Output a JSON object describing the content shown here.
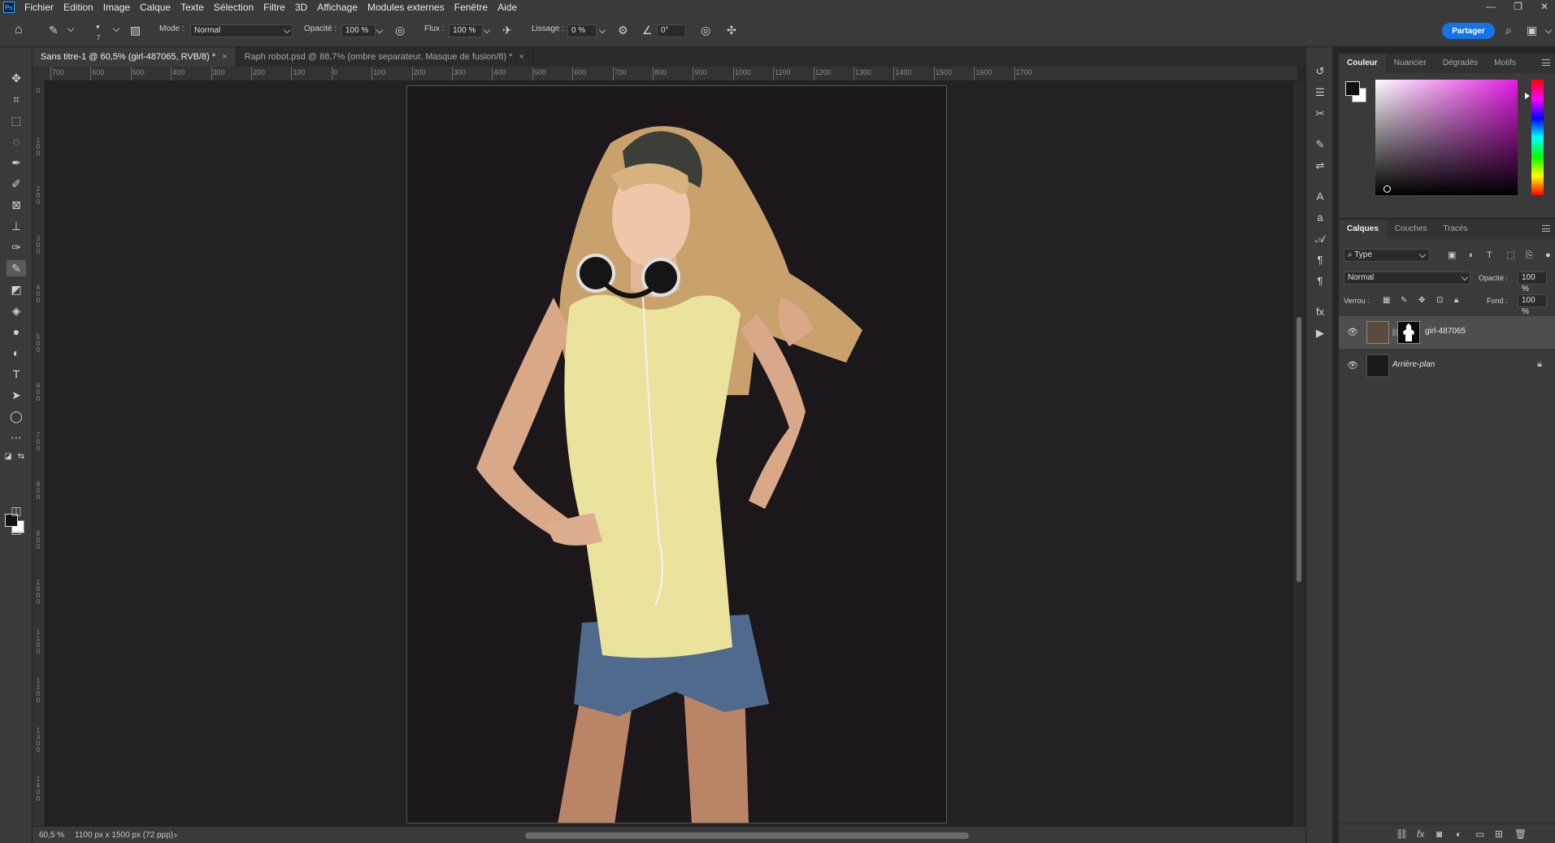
{
  "app": {
    "logo": "Ps"
  },
  "menu": [
    "Fichier",
    "Edition",
    "Image",
    "Calque",
    "Texte",
    "Sélection",
    "Filtre",
    "3D",
    "Affichage",
    "Modules externes",
    "Fenêtre",
    "Aide"
  ],
  "window_controls": [
    "—",
    "❐",
    "✕"
  ],
  "options": {
    "brush_size": "7",
    "mode_label": "Mode :",
    "mode_value": "Normal",
    "opacity_label": "Opacité :",
    "opacity_value": "100 %",
    "flow_label": "Flux :",
    "flow_value": "100 %",
    "smoothing_label": "Lissage :",
    "smoothing_value": "0 %",
    "angle_value": "0°",
    "share_label": "Partager"
  },
  "tabs": [
    {
      "label": "Sans titre-1 @ 60,5% (girl-487065, RVB/8) *",
      "active": true
    },
    {
      "label": "Raph robot.psd @ 88,7% (ombre separateur, Masque de fusion/8) *",
      "active": false
    }
  ],
  "ruler_h": [
    "700",
    "600",
    "500",
    "400",
    "300",
    "200",
    "100",
    "0",
    "100",
    "200",
    "300",
    "400",
    "500",
    "600",
    "700",
    "800",
    "900",
    "1000",
    "1100",
    "1200",
    "1300",
    "1400",
    "1500",
    "1600",
    "1700"
  ],
  "ruler_v": [
    "0",
    "1\n0\n0",
    "2\n0\n0",
    "3\n0\n0",
    "4\n0\n0",
    "5\n0\n0",
    "6\n0\n0",
    "7\n0\n0",
    "8\n0\n0",
    "9\n0\n0",
    "1\n0\n0\n0",
    "1\n1\n0\n0",
    "1\n2\n0\n0",
    "1\n3\n0\n0",
    "1\n4\n0\n0"
  ],
  "status": {
    "zoom": "60,5 %",
    "doc_size": "1100 px x 1500 px (72 ppp)",
    "arrow": "›"
  },
  "color_panel": {
    "tabs": [
      "Couleur",
      "Nuancier",
      "Dégradés",
      "Motifs"
    ],
    "foreground": "#111111",
    "background": "#ffffff",
    "hue_color": "#e31ce3"
  },
  "layers_panel": {
    "tabs": [
      "Calques",
      "Couches",
      "Tracés"
    ],
    "filter_value": "Type",
    "blend_value": "Normal",
    "opacity_label": "Opacité :",
    "opacity_value": "100 %",
    "lock_label": "Verrou :",
    "fill_label": "Fond :",
    "fill_value": "100 %",
    "layers": [
      {
        "name": "girl-487065",
        "selected": true,
        "visible": true
      },
      {
        "name": "Arrière-plan",
        "selected": false,
        "visible": true,
        "locked": true
      }
    ]
  },
  "tools": [
    "move-icon",
    "crop-icon",
    "marquee-icon",
    "lasso-icon",
    "pen-icon",
    "quick-select-icon",
    "frame-icon",
    "stamp-icon",
    "eyedropper-icon",
    "brush-icon",
    "eraser-icon",
    "bucket-icon",
    "blur-icon",
    "dodge-icon",
    "type-icon",
    "path-select-icon",
    "ellipse-icon",
    "more-icon",
    "quick-mask-icon",
    "screen-mode-icon"
  ]
}
